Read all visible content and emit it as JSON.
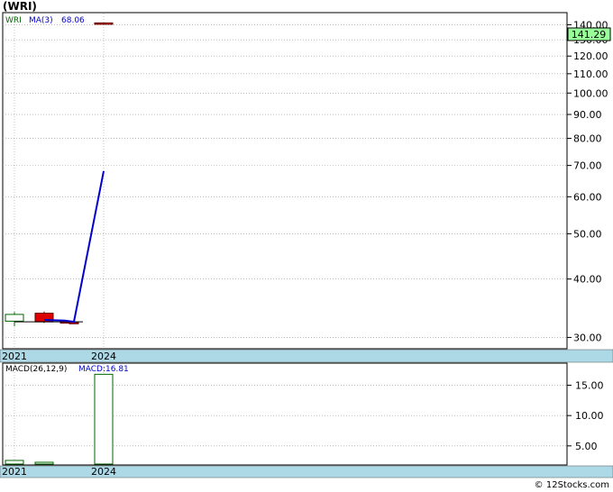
{
  "ticker_label": "(WRI)",
  "footer": "© 12Stocks.com",
  "colors": {
    "ma_line": "#0000cc",
    "up_candle": "#006600",
    "down_candle": "#dd0000",
    "axis_band": "#add8e6",
    "price_tag_bg": "#99ff99",
    "grid": "#999999"
  },
  "chart_data": [
    {
      "type": "candlestick",
      "panel": "price",
      "legend": {
        "symbol": "WRI",
        "ma_label": "MA(3)",
        "ma_value": "68.06"
      },
      "y_scale": "log",
      "ylim": [
        28.5,
        148
      ],
      "y_ticks": [
        30,
        40,
        50,
        60,
        70,
        80,
        90,
        100,
        110,
        120,
        130,
        140
      ],
      "y_tick_labels": [
        "30.00",
        "40.00",
        "50.00",
        "60.00",
        "70.00",
        "80.00",
        "90.00",
        "100.00",
        "110.00",
        "120.00",
        "130.00",
        "140.00"
      ],
      "last_price_label": "141.29",
      "last_price": 141.29,
      "x_labels": [
        "2021",
        "2024"
      ],
      "candles": [
        {
          "open": 32.5,
          "close": 33.6,
          "high": 34.0,
          "low": 31.7,
          "color": "up"
        },
        {
          "open": 33.8,
          "close": 32.4,
          "high": 34.1,
          "low": 32.2,
          "color": "down"
        },
        {
          "open": 32.3,
          "close": 32.4,
          "high": 32.5,
          "low": 32.2,
          "color": "down"
        },
        {
          "open": 32.3,
          "close": 32.3,
          "high": 32.3,
          "low": 32.3,
          "color": "down"
        },
        {
          "open": 141.29,
          "close": 141.29,
          "high": 141.5,
          "low": 141.0,
          "color": "down"
        }
      ],
      "ma_series": [
        null,
        32.7,
        32.6,
        32.4,
        68.06
      ]
    },
    {
      "type": "bar",
      "panel": "macd",
      "legend": {
        "label": "MACD(26,12,9)",
        "value_label": "MACD:16.81"
      },
      "ylim": [
        2,
        18.5
      ],
      "y_ticks": [
        5,
        10,
        15
      ],
      "y_tick_labels": [
        "5.00",
        "10.00",
        "15.00"
      ],
      "x_labels": [
        "2021",
        "2024"
      ],
      "values": [
        2.6,
        2.3,
        null,
        null,
        16.81
      ]
    }
  ]
}
